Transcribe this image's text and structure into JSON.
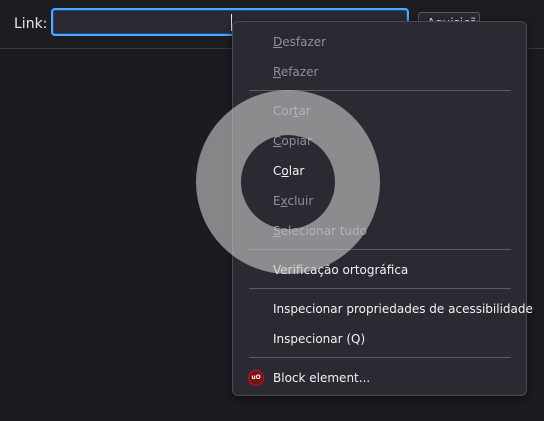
{
  "toolbar": {
    "link_label": "Link:",
    "link_value": "",
    "apply_label": "Aquisição"
  },
  "context_menu": {
    "items": [
      {
        "label": "Desfazer",
        "access_key": "D",
        "rest": "esfazer",
        "enabled": false
      },
      {
        "label": "Refazer",
        "access_key": "R",
        "rest": "efazer",
        "enabled": false
      },
      {
        "label": "Cortar",
        "pre": "Cor",
        "access_key": "t",
        "rest": "ar",
        "enabled": false
      },
      {
        "label": "Copiar",
        "access_key": "C",
        "rest": "opiar",
        "enabled": false
      },
      {
        "label": "Colar",
        "pre": "C",
        "access_key": "o",
        "rest": "lar",
        "enabled": true
      },
      {
        "label": "Excluir",
        "pre": "E",
        "access_key": "x",
        "rest": "cluir",
        "enabled": false
      },
      {
        "label": "Selecionar tudo",
        "access_key": "S",
        "rest": "elecionar tudo",
        "enabled": false
      },
      {
        "label": "Verificação ortográfica",
        "enabled": true
      },
      {
        "label": "Inspecionar propriedades de acessibilidade",
        "enabled": true
      },
      {
        "label": "Inspecionar (Q)",
        "enabled": true
      },
      {
        "label": "Block element...",
        "enabled": true,
        "icon": "ublock-origin-icon",
        "icon_text": "uO"
      }
    ]
  },
  "colors": {
    "background": "#1c1b22",
    "menu_background": "#2b2a33",
    "focus_ring": "#54a9ff",
    "disabled_text": "#8f8f9d",
    "enabled_text": "#f2f2f5"
  }
}
